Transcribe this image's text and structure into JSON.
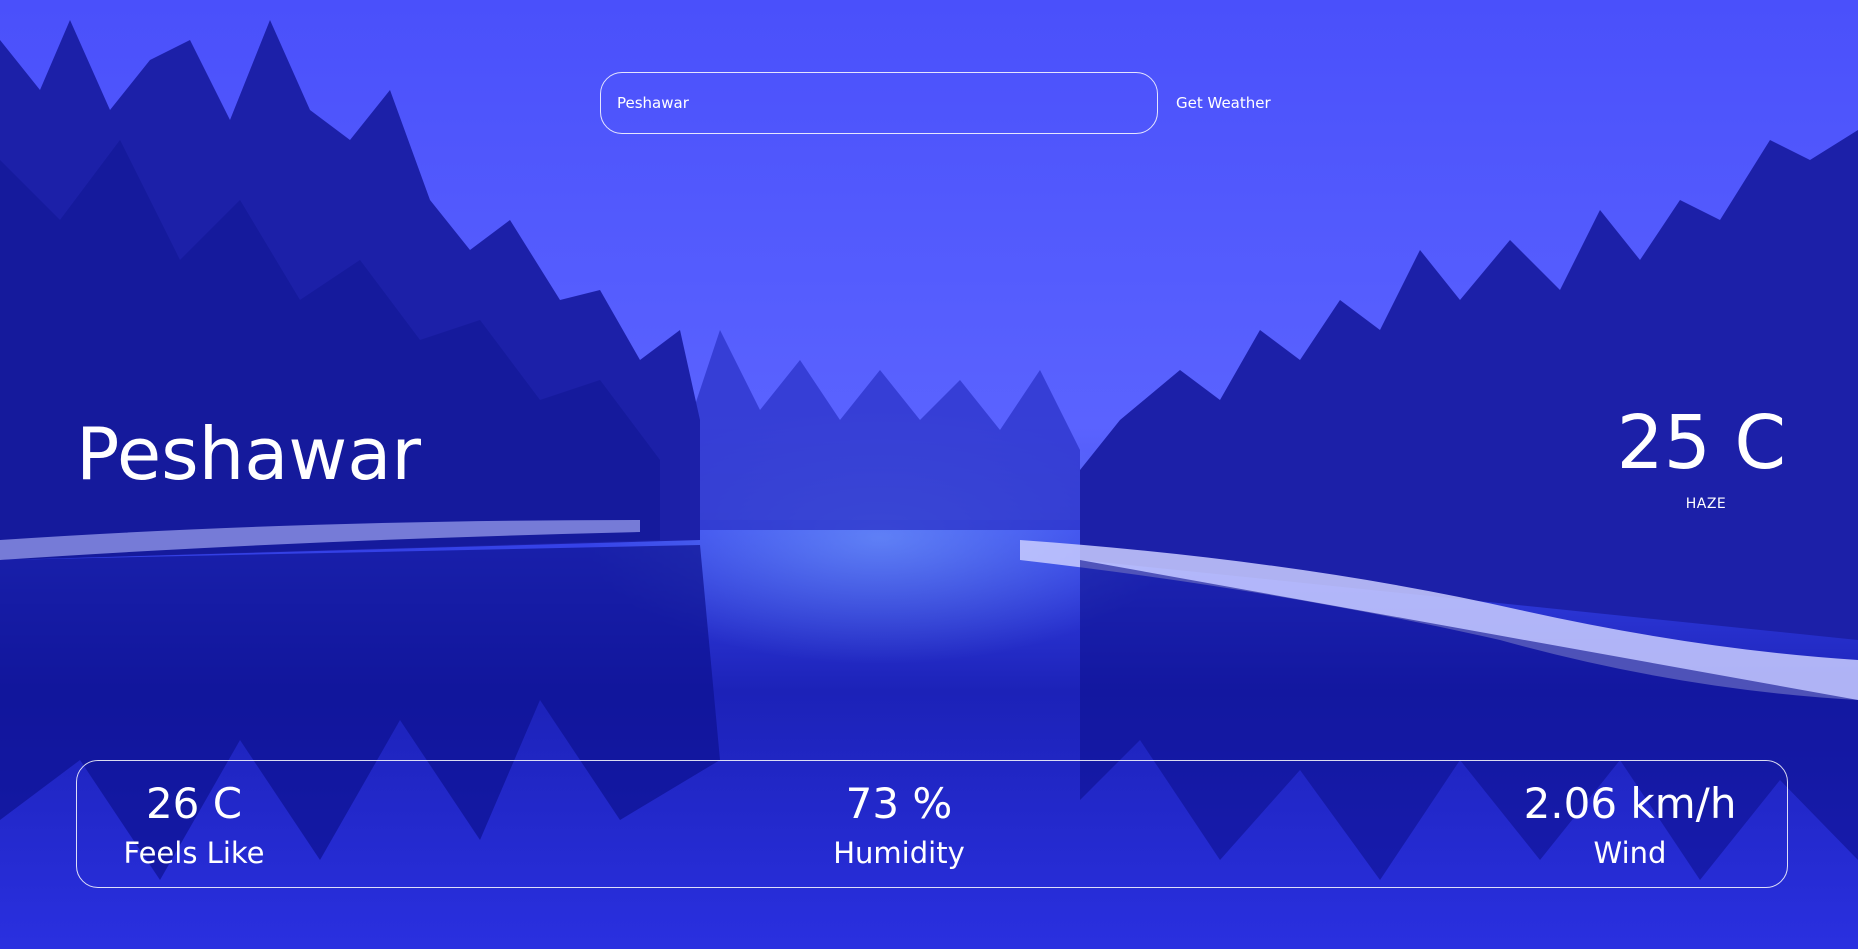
{
  "search": {
    "value": "Peshawar",
    "button_label": "Get Weather"
  },
  "current": {
    "city": "Peshawar",
    "temperature": "25 C",
    "condition": "HAZE"
  },
  "details": {
    "feels_like": {
      "value": "26 C",
      "label": "Feels Like"
    },
    "humidity": {
      "value": "73 %",
      "label": "Humidity"
    },
    "wind": {
      "value": "2.06 km/h",
      "label": "Wind"
    }
  },
  "background": {
    "description_icon": "winter-lake-landscape",
    "tint_color": "#4048f5"
  }
}
